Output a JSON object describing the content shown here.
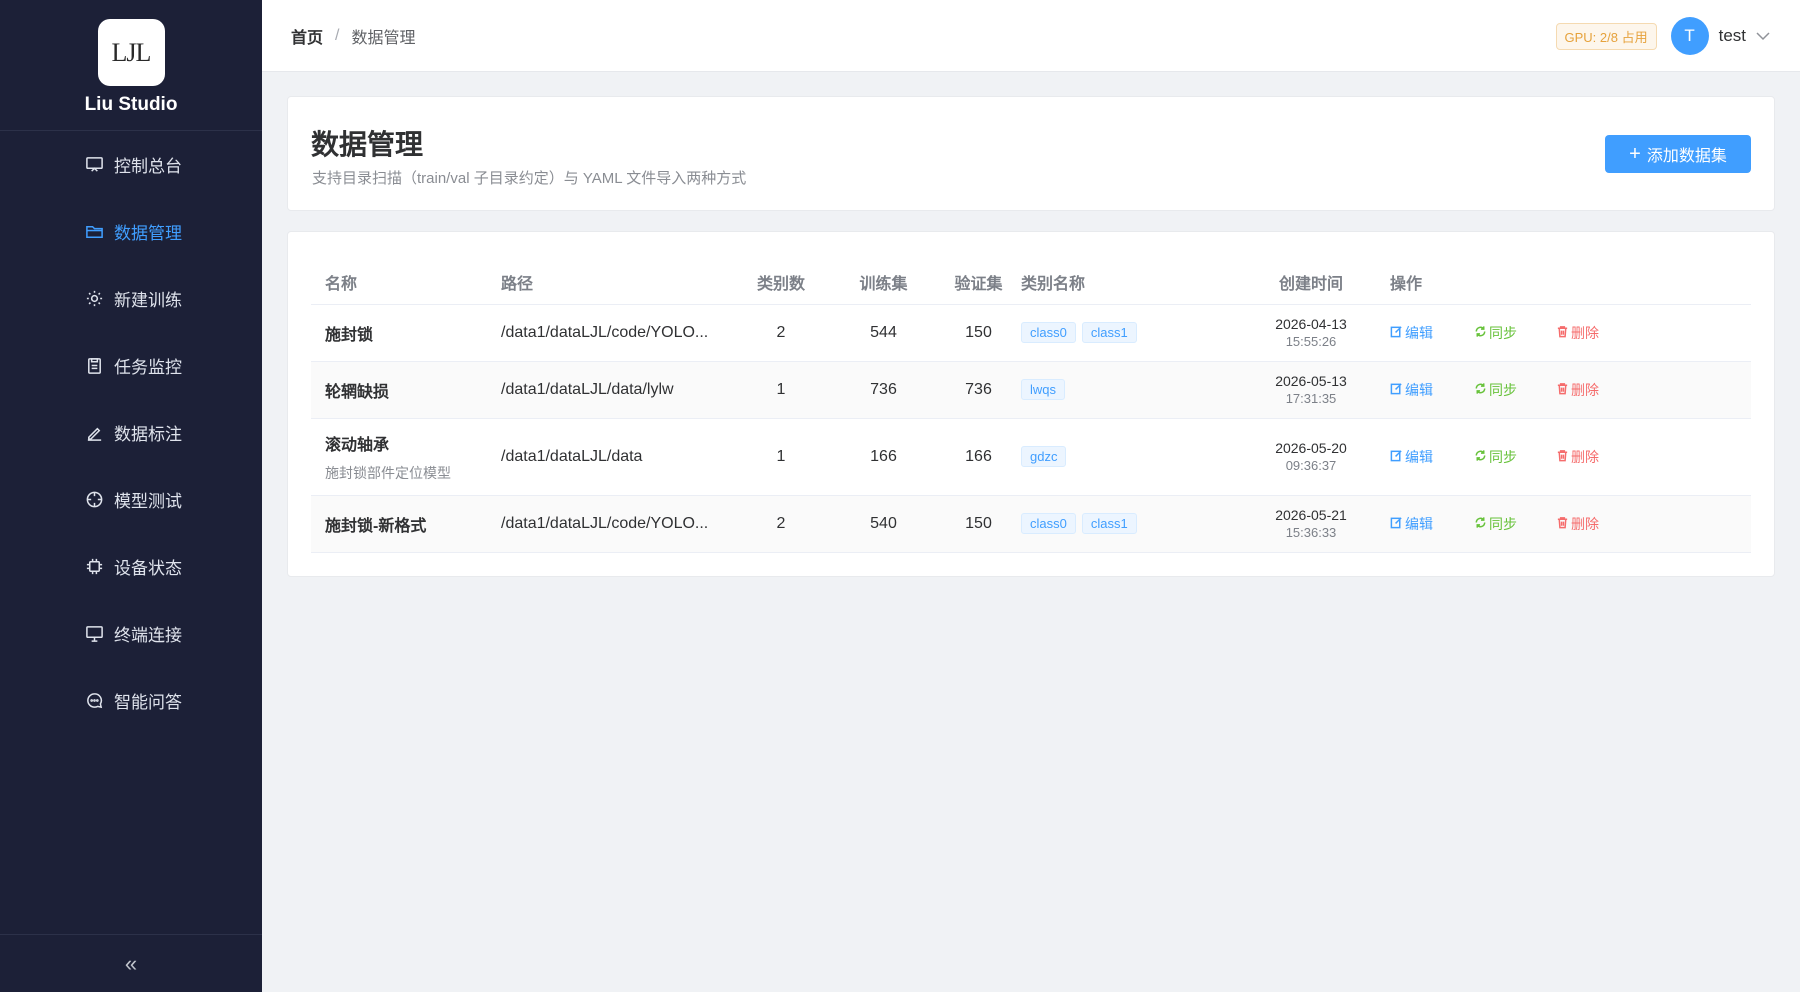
{
  "brand": {
    "logo_text": "LJL",
    "name": "Liu Studio"
  },
  "sidebar": {
    "items": [
      {
        "label": "控制总台",
        "icon": "dashboard-icon"
      },
      {
        "label": "数据管理",
        "icon": "folder-icon",
        "active": true
      },
      {
        "label": "新建训练",
        "icon": "gear-icon"
      },
      {
        "label": "任务监控",
        "icon": "clipboard-icon"
      },
      {
        "label": "数据标注",
        "icon": "pen-icon"
      },
      {
        "label": "模型测试",
        "icon": "target-icon"
      },
      {
        "label": "设备状态",
        "icon": "chip-icon"
      },
      {
        "label": "终端连接",
        "icon": "monitor-icon"
      },
      {
        "label": "智能问答",
        "icon": "chat-icon"
      }
    ],
    "collapse_glyph": "«"
  },
  "header": {
    "breadcrumb_home": "首页",
    "breadcrumb_sep": "/",
    "breadcrumb_current": "数据管理",
    "gpu_badge": "GPU: 2/8 占用",
    "avatar_letter": "T",
    "username": "test"
  },
  "page": {
    "title": "数据管理",
    "subtitle": "支持目录扫描（train/val 子目录约定）与 YAML 文件导入两种方式",
    "add_button": "添加数据集"
  },
  "table": {
    "columns": {
      "name": "名称",
      "path": "路径",
      "class_count": "类别数",
      "train": "训练集",
      "val": "验证集",
      "class_names": "类别名称",
      "created": "创建时间",
      "actions": "操作"
    },
    "action_labels": {
      "edit": "编辑",
      "sync": "同步",
      "delete": "删除"
    },
    "rows": [
      {
        "name": "施封锁",
        "desc": "",
        "path": "/data1/dataLJL/code/YOLO...",
        "class_count": "2",
        "train": "544",
        "val": "150",
        "tags": [
          "class0",
          "class1"
        ],
        "date": "2026-04-13",
        "time": "15:55:26"
      },
      {
        "name": "轮辋缺损",
        "desc": "",
        "path": "/data1/dataLJL/data/lylw",
        "class_count": "1",
        "train": "736",
        "val": "736",
        "tags": [
          "lwqs"
        ],
        "date": "2026-05-13",
        "time": "17:31:35"
      },
      {
        "name": "滚动轴承",
        "desc": "施封锁部件定位模型",
        "path": "/data1/dataLJL/data",
        "class_count": "1",
        "train": "166",
        "val": "166",
        "tags": [
          "gdzc"
        ],
        "date": "2026-05-20",
        "time": "09:36:37"
      },
      {
        "name": "施封锁-新格式",
        "desc": "",
        "path": "/data1/dataLJL/code/YOLO...",
        "class_count": "2",
        "train": "540",
        "val": "150",
        "tags": [
          "class0",
          "class1"
        ],
        "date": "2026-05-21",
        "time": "15:36:33"
      }
    ]
  },
  "colors": {
    "sidebar_bg": "#1c2037",
    "accent": "#409eff",
    "success": "#67c23a",
    "danger": "#f56c6c",
    "warning": "#e6a23c"
  }
}
